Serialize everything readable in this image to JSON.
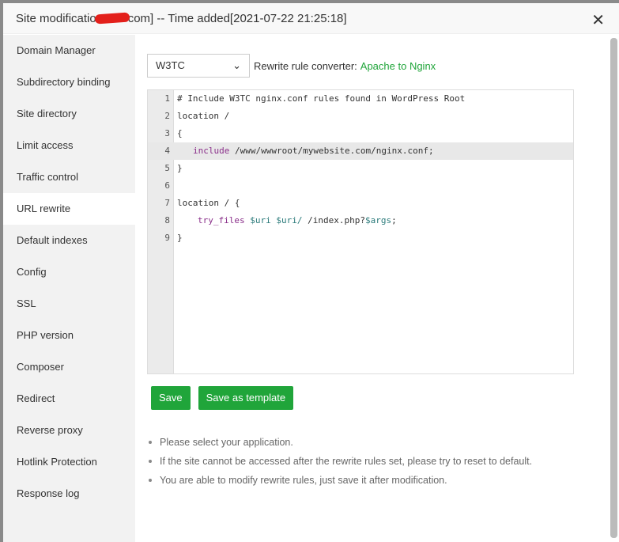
{
  "title": {
    "prefix": "Site modificatio",
    "suffix": "com] -- Time added[2021-07-22 21:25:18]"
  },
  "sidebar": {
    "items": [
      "Domain Manager",
      "Subdirectory binding",
      "Site directory",
      "Limit access",
      "Traffic control",
      "URL rewrite",
      "Default indexes",
      "Config",
      "SSL",
      "PHP version",
      "Composer",
      "Redirect",
      "Reverse proxy",
      "Hotlink Protection",
      "Response log"
    ],
    "active": "URL rewrite"
  },
  "select": {
    "value": "W3TC"
  },
  "converter": {
    "label": "Rewrite rule converter:",
    "link": "Apache to Nginx"
  },
  "code": {
    "n": [
      "1",
      "2",
      "3",
      "4",
      "5",
      "6",
      "7",
      "8",
      "9"
    ],
    "l1": "# Include W3TC nginx.conf rules found in WordPress Root",
    "l2": "location /",
    "l3": "{",
    "l4kw": "include",
    "l4": " /www/wwwroot/mywebsite.com/nginx.conf;",
    "l5": "}",
    "l7": "location / {",
    "l8kw": "try_files",
    "l8v1": "$uri",
    "l8v2": "$uri/",
    "l8rest": " /index.php?",
    "l8v3": "$args",
    "l8end": ";",
    "l9": "}"
  },
  "buttons": {
    "save": "Save",
    "template": "Save as template"
  },
  "tips": [
    "Please select your application.",
    "If the site cannot be accessed after the rewrite rules set, please try to reset to default.",
    "You are able to modify rewrite rules, just save it after modification."
  ]
}
